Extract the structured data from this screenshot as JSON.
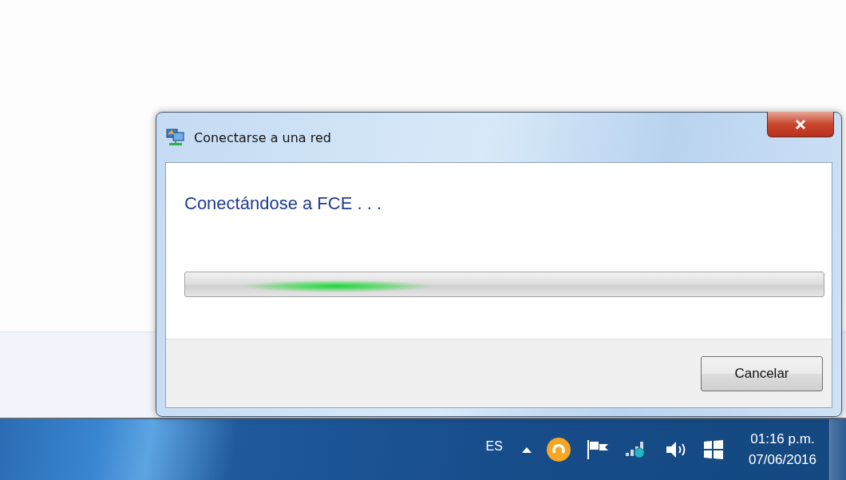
{
  "dialog": {
    "title": "Conectarse a una red",
    "heading": "Conectándose a FCE . . .",
    "progress": {
      "indeterminate": true
    },
    "buttons": [
      {
        "label": "Cancelar"
      }
    ]
  },
  "taskbar": {
    "language": "ES",
    "time": "01:16 p.m.",
    "date": "07/06/2016"
  }
}
